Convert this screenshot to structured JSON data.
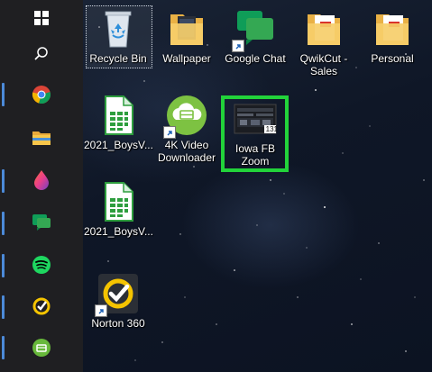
{
  "desktop": {
    "icons": [
      {
        "id": "recycle-bin",
        "label": "Recycle Bin"
      },
      {
        "id": "wallpaper",
        "label": "Wallpaper"
      },
      {
        "id": "google-chat",
        "label": "Google Chat"
      },
      {
        "id": "qwikcut-sales",
        "label": "QwikCut -\nSales"
      },
      {
        "id": "personal",
        "label": "Personal"
      },
      {
        "id": "boys-sheet-1",
        "label": "2021_BoysV..."
      },
      {
        "id": "4k-video-downloader",
        "label": "4K Video\nDownloader"
      },
      {
        "id": "iowa-fb-zoom",
        "label": "Iowa FB\nZoom"
      },
      {
        "id": "boys-sheet-2",
        "label": "2021_BoysV..."
      },
      {
        "id": "norton-360",
        "label": "Norton 360"
      }
    ],
    "thumbnail_badge": "131"
  },
  "taskbar": {
    "items": [
      {
        "name": "start-button",
        "icon": "windows-logo-icon"
      },
      {
        "name": "search-button",
        "icon": "search-icon"
      },
      {
        "name": "chrome-button",
        "icon": "chrome-icon"
      },
      {
        "name": "file-explorer-button",
        "icon": "folder-icon"
      },
      {
        "name": "drop-app-button",
        "icon": "drop-icon"
      },
      {
        "name": "google-chat-button",
        "icon": "chat-icon"
      },
      {
        "name": "spotify-button",
        "icon": "spotify-icon"
      },
      {
        "name": "norton-button",
        "icon": "norton-icon"
      },
      {
        "name": "downloader-button",
        "icon": "downloader-icon"
      }
    ]
  },
  "colors": {
    "highlight": "#22d33a",
    "taskbar": "#1f1f22",
    "indicator": "#4c8ad9"
  }
}
